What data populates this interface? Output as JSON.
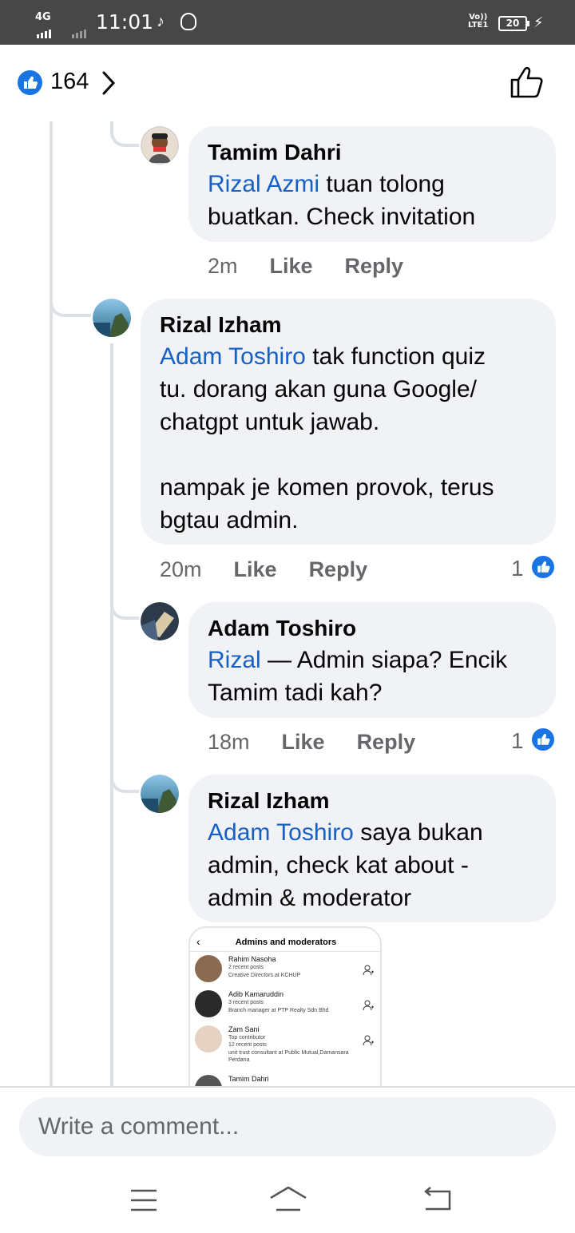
{
  "status_bar": {
    "network": "4G",
    "time": "11:01",
    "volte_line1": "Vo))",
    "volte_line2": "LTE1",
    "battery": "20"
  },
  "header": {
    "like_count": "164"
  },
  "comments": [
    {
      "author": "Tamim Dahri",
      "mention": "Rizal Azmi",
      "text": " tuan tolong\nbuatkan. Check invitation",
      "time": "2m",
      "like_label": "Like",
      "reply_label": "Reply"
    },
    {
      "author": "Rizal Izham",
      "mention": "Adam Toshiro",
      "text": " tak function quiz\ntu. dorang akan guna Google/\nchatgpt untuk jawab.\n\nnampak je komen provok, terus\nbgtau admin.",
      "time": "20m",
      "like_label": "Like",
      "reply_label": "Reply",
      "reactions": "1"
    },
    {
      "author": "Adam Toshiro",
      "mention": "Rizal",
      "text": " — Admin siapa? Encik\nTamim tadi kah?",
      "time": "18m",
      "like_label": "Like",
      "reply_label": "Reply",
      "reactions": "1"
    },
    {
      "author": "Rizal Izham",
      "mention": "Adam Toshiro",
      "text": " saya bukan\nadmin, check kat about -\nadmin & moderator"
    }
  ],
  "attachment": {
    "title": "Admins and moderators",
    "rows": [
      {
        "name": "Rahim Nasoha",
        "line1": "2 recent posts",
        "line2": "Creative Directors at KCHUP"
      },
      {
        "name": "Adib Kamaruddin",
        "line1": "3 recent posts",
        "line2": "Branch manager at PTP Realty Sdn Bhd"
      },
      {
        "name": "Zam Sani",
        "line1": "Top contributor",
        "line2": "12 recent posts",
        "line3": "unit trust consultant at Public Mutual,Damansara",
        "line4": "Perdana"
      },
      {
        "name": "Tamim Dahri"
      }
    ]
  },
  "composer": {
    "placeholder": "Write a comment..."
  },
  "icons": {
    "like_reaction": "thumbs-up-in-blue-circle",
    "header_like": "thumbs-up-outline",
    "chevron": "chevron-right"
  },
  "colors": {
    "brand_blue": "#1b74e4",
    "mention": "#1660c4",
    "bubble": "#f0f2f5",
    "status_bar": "#474747"
  }
}
